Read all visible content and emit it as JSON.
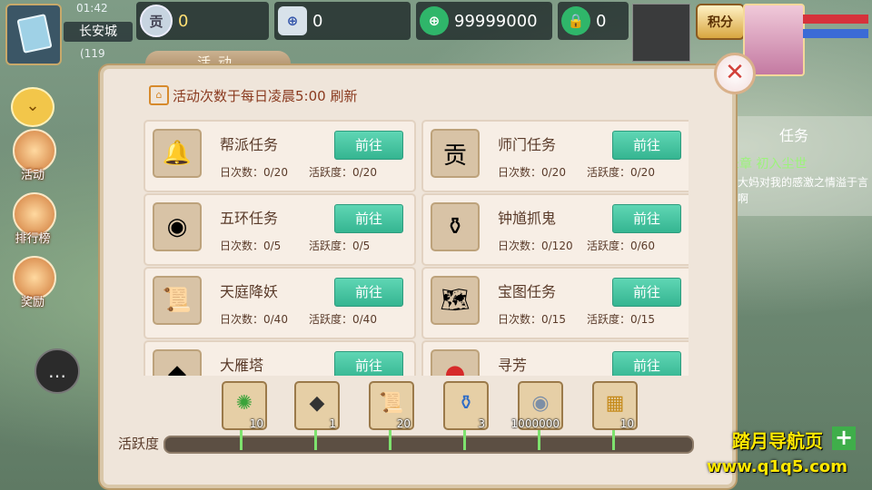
{
  "topbar": {
    "time": "01:42",
    "city": "长安城",
    "coords": "(119",
    "resources": [
      {
        "icon": "gong-token-icon",
        "glyph": "贡",
        "value": "0"
      },
      {
        "icon": "silver-ingot-icon",
        "glyph": "",
        "value": "0"
      },
      {
        "icon": "jade-coin-icon",
        "glyph": "",
        "value": "99999000"
      },
      {
        "icon": "locked-jade-icon",
        "glyph": "",
        "value": "0"
      }
    ],
    "points_label": "积分"
  },
  "sidebar": {
    "buttons": [
      {
        "label": "活动",
        "icon": "trumpet-icon"
      },
      {
        "label": "排行榜",
        "icon": "ranking-icon"
      },
      {
        "label": "奖励",
        "icon": "giftbox-icon"
      }
    ]
  },
  "quest": {
    "title": "任务",
    "name": "录章 初入尘世",
    "desc": "王大妈对我的感激之情溢于言表啊"
  },
  "dialog": {
    "tab": "活动",
    "notice": "活动次数于每日凌晨5:00 刷新",
    "go_label": "前往",
    "activities": [
      {
        "name": "帮派任务",
        "icon": "guild-bell-icon",
        "glyph": "🔔",
        "daily": "日次数：0/20",
        "active": "活跃度：0/20"
      },
      {
        "name": "师门任务",
        "icon": "gong-token-icon",
        "glyph": "贡",
        "daily": "日次数：0/20",
        "active": "活跃度：0/20"
      },
      {
        "name": "五环任务",
        "icon": "silver-ingot-icon",
        "glyph": "◉",
        "daily": "日次数：0/5",
        "active": "活跃度：0/5"
      },
      {
        "name": "钟馗抓鬼",
        "icon": "vase-icon",
        "glyph": "⚱",
        "daily": "日次数：0/120",
        "active": "活跃度：0/60"
      },
      {
        "name": "天庭降妖",
        "icon": "scroll-icon",
        "glyph": "📜",
        "daily": "日次数：0/40",
        "active": "活跃度：0/40"
      },
      {
        "name": "宝图任务",
        "icon": "treasure-map-icon",
        "glyph": "🗺",
        "daily": "日次数：0/15",
        "active": "活跃度：0/15"
      },
      {
        "name": "大雁塔",
        "icon": "dark-stone-icon",
        "glyph": "◆",
        "daily": "",
        "active": ""
      },
      {
        "name": "寻芳",
        "icon": "red-flower-icon",
        "glyph": "●",
        "daily": "",
        "active": ""
      }
    ],
    "activity_label": "活跃度",
    "rewards": [
      {
        "icon": "green-orb-icon",
        "glyph": "✺",
        "qty": "10"
      },
      {
        "icon": "dark-stone-icon",
        "glyph": "◆",
        "qty": "1"
      },
      {
        "icon": "scroll-icon",
        "glyph": "📜",
        "qty": "20"
      },
      {
        "icon": "vase-icon",
        "glyph": "⚱",
        "qty": "3"
      },
      {
        "icon": "silver-ingot-icon",
        "glyph": "◉",
        "qty": "1000000"
      },
      {
        "icon": "golden-book-icon",
        "glyph": "▦",
        "qty": "10"
      }
    ],
    "activity_progress": 0
  },
  "watermark": {
    "line1": "踏月导航页",
    "line2": "www.q1q5.com"
  }
}
